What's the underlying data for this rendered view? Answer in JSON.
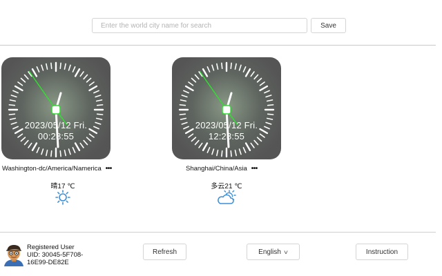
{
  "search": {
    "placeholder": "Enter the world city name for search",
    "value": "",
    "save_label": "Save"
  },
  "clocks": [
    {
      "date": "2023/05/12 Fri.",
      "time": "00:28:55",
      "city": "Washington-dc/America/Namerica",
      "weather": "晴17 ℃",
      "weather_icon": "sun-icon"
    },
    {
      "date": "2023/05/12 Fri.",
      "time": "12:28:55",
      "city": "Shanghai/China/Asia",
      "weather": "多云21 ℃",
      "weather_icon": "partly-cloudy-icon"
    }
  ],
  "more_label": "•••",
  "footer": {
    "user_line1": "Registered User",
    "user_line2": "UID: 30045-5F708-",
    "user_line3": "16E99-DE82E",
    "refresh_label": "Refresh",
    "language_label": "English",
    "instruction_label": "Instruction"
  },
  "colors": {
    "clock_face": "#555555",
    "second_hand": "#33dd33",
    "weather_icon": "#3b8fd9"
  }
}
